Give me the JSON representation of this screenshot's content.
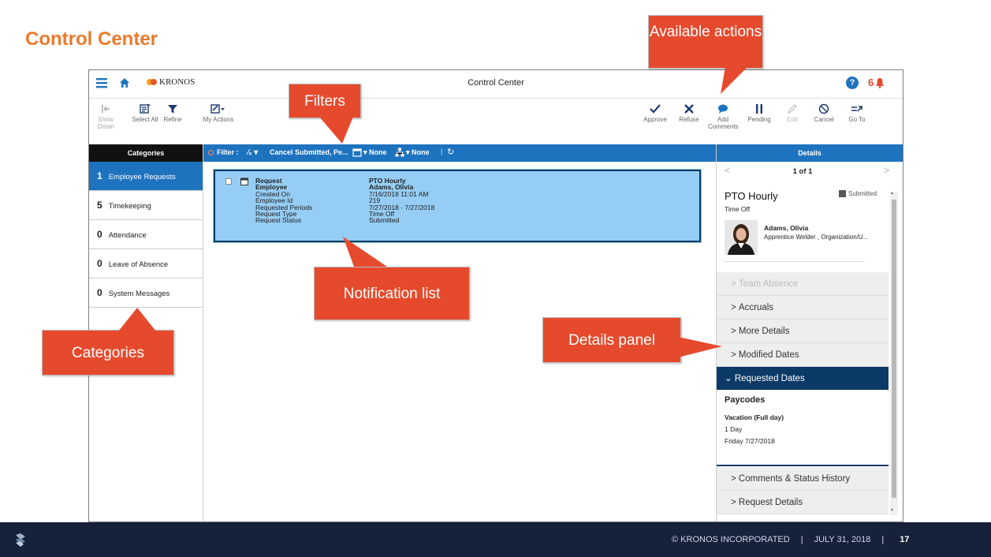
{
  "slide": {
    "title": "Control Center",
    "page_number": "17"
  },
  "app": {
    "brand": "KRONOS",
    "window_title": "Control Center",
    "help_icon": "help-icon",
    "notification_count": "6"
  },
  "toolbar": {
    "left": [
      {
        "label": "Show Detail",
        "icon": "show-detail-icon"
      },
      {
        "label": "Select All",
        "icon": "select-all-icon"
      },
      {
        "label": "Refine",
        "icon": "refine-icon"
      },
      {
        "label": "My Actions",
        "icon": "my-actions-icon"
      }
    ],
    "right": [
      {
        "label": "Approve",
        "icon": "check-icon"
      },
      {
        "label": "Refuse",
        "icon": "x-icon"
      },
      {
        "label": "Add Comments",
        "icon": "comment-icon"
      },
      {
        "label": "Pending",
        "icon": "pause-icon"
      },
      {
        "label": "Edit",
        "icon": "pencil-icon"
      },
      {
        "label": "Cancel",
        "icon": "cancel-icon"
      },
      {
        "label": "Go To",
        "icon": "goto-icon"
      }
    ]
  },
  "filter": {
    "prefix": "Filter :",
    "status_value": "Cancel Submitted, Pe...",
    "date_value": "None",
    "org_value": "None"
  },
  "categories": {
    "header": "Categories",
    "items": [
      {
        "count": "1",
        "label": "Employee Requests"
      },
      {
        "count": "5",
        "label": "Timekeeping"
      },
      {
        "count": "0",
        "label": "Attendance"
      },
      {
        "count": "0",
        "label": "Leave of Absence"
      },
      {
        "count": "0",
        "label": "System Messages"
      }
    ]
  },
  "notification": {
    "fields": [
      {
        "label": "Request",
        "value": "PTO Hourly"
      },
      {
        "label": "Employee",
        "value": "Adams, Olivia"
      },
      {
        "label": "Created On",
        "value": "7/16/2018 11:01 AM"
      },
      {
        "label": "Employee Id",
        "value": "219"
      },
      {
        "label": "Requested Periods",
        "value": "7/27/2018 - 7/27/2018"
      },
      {
        "label": "Request Type",
        "value": "Time Off"
      },
      {
        "label": "Request Status",
        "value": "Submitted"
      }
    ]
  },
  "details": {
    "header": "Details",
    "pager": "1 of 1",
    "title": "PTO Hourly",
    "status": "Submitted",
    "subtitle": "Time Off",
    "employee_name": "Adams, Olivia",
    "employee_role": "Apprentice Welder , Organization/U...",
    "sections": [
      {
        "label": "Team Absence"
      },
      {
        "label": "Accruals"
      },
      {
        "label": "More Details"
      },
      {
        "label": "Modified Dates"
      },
      {
        "label": "Requested Dates"
      }
    ],
    "paycodes_title": "Paycodes",
    "paycode_name": "Vacation (Full day)",
    "paycode_amount": "1 Day",
    "paycode_date": "Friday 7/27/2018",
    "bottom_sections": [
      {
        "label": "Comments & Status History"
      },
      {
        "label": "Request Details"
      }
    ]
  },
  "callouts": {
    "filters": "Filters",
    "available_actions": "Available actions",
    "notification_list": "Notification list",
    "details_panel": "Details panel",
    "categories": "Categories"
  },
  "footer": {
    "copyright": "© KRONOS INCORPORATED",
    "date": "JULY 31, 2018",
    "page": "17"
  },
  "colors": {
    "accent": "#ea7a2c",
    "blue": "#1e73be",
    "callout": "#e64a2d",
    "navy": "#0c3a66"
  }
}
